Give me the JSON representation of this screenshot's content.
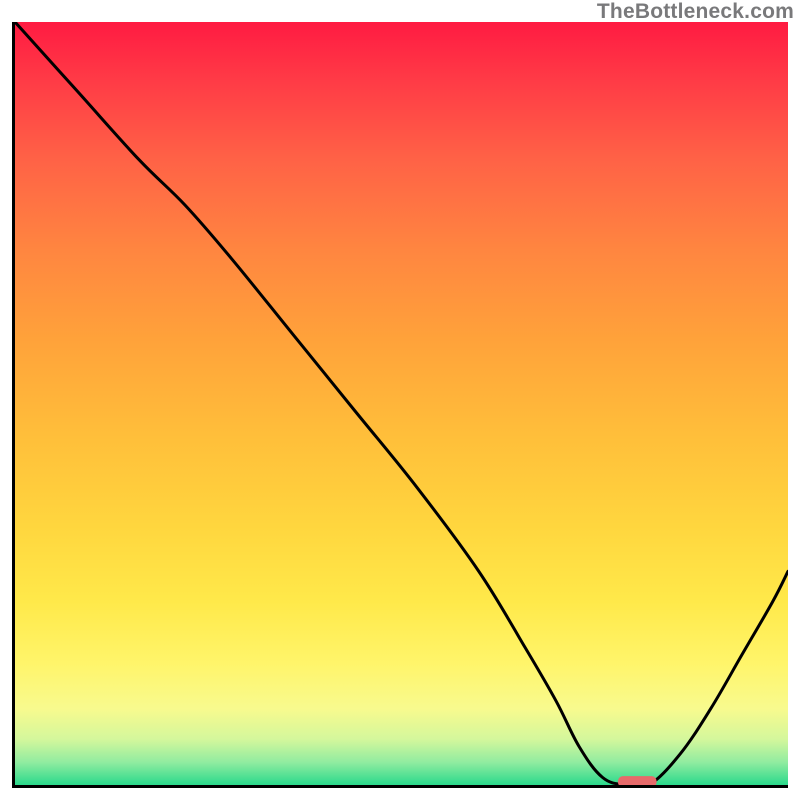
{
  "watermark": "TheBottleneck.com",
  "chart_data": {
    "type": "line",
    "title": "",
    "xlabel": "",
    "ylabel": "",
    "xlim": [
      0,
      100
    ],
    "ylim": [
      0,
      100
    ],
    "background_gradient_stops": [
      {
        "pct": 0,
        "color": "#ff1b42"
      },
      {
        "pct": 8,
        "color": "#ff3c46"
      },
      {
        "pct": 18,
        "color": "#ff6246"
      },
      {
        "pct": 30,
        "color": "#ff8640"
      },
      {
        "pct": 42,
        "color": "#ffa33a"
      },
      {
        "pct": 54,
        "color": "#ffbe3a"
      },
      {
        "pct": 66,
        "color": "#ffd63e"
      },
      {
        "pct": 76,
        "color": "#ffe94a"
      },
      {
        "pct": 84,
        "color": "#fff56a"
      },
      {
        "pct": 90,
        "color": "#f8fa8e"
      },
      {
        "pct": 94,
        "color": "#d4f79c"
      },
      {
        "pct": 97,
        "color": "#91eca0"
      },
      {
        "pct": 100,
        "color": "#2bd98c"
      }
    ],
    "series": [
      {
        "name": "bottleneck-curve",
        "color": "#000000",
        "x": [
          0,
          8,
          16,
          22,
          28,
          36,
          44,
          52,
          60,
          66,
          70,
          73,
          76,
          79,
          82,
          86,
          90,
          94,
          98,
          100
        ],
        "y": [
          100,
          91,
          82,
          76,
          69,
          59,
          49,
          39,
          28,
          18,
          11,
          5,
          1,
          0,
          0,
          4,
          10,
          17,
          24,
          28
        ]
      }
    ],
    "marker": {
      "name": "optimum-marker",
      "x": 80.5,
      "y": 0.5,
      "width": 5,
      "color": "#e66a6a"
    }
  }
}
